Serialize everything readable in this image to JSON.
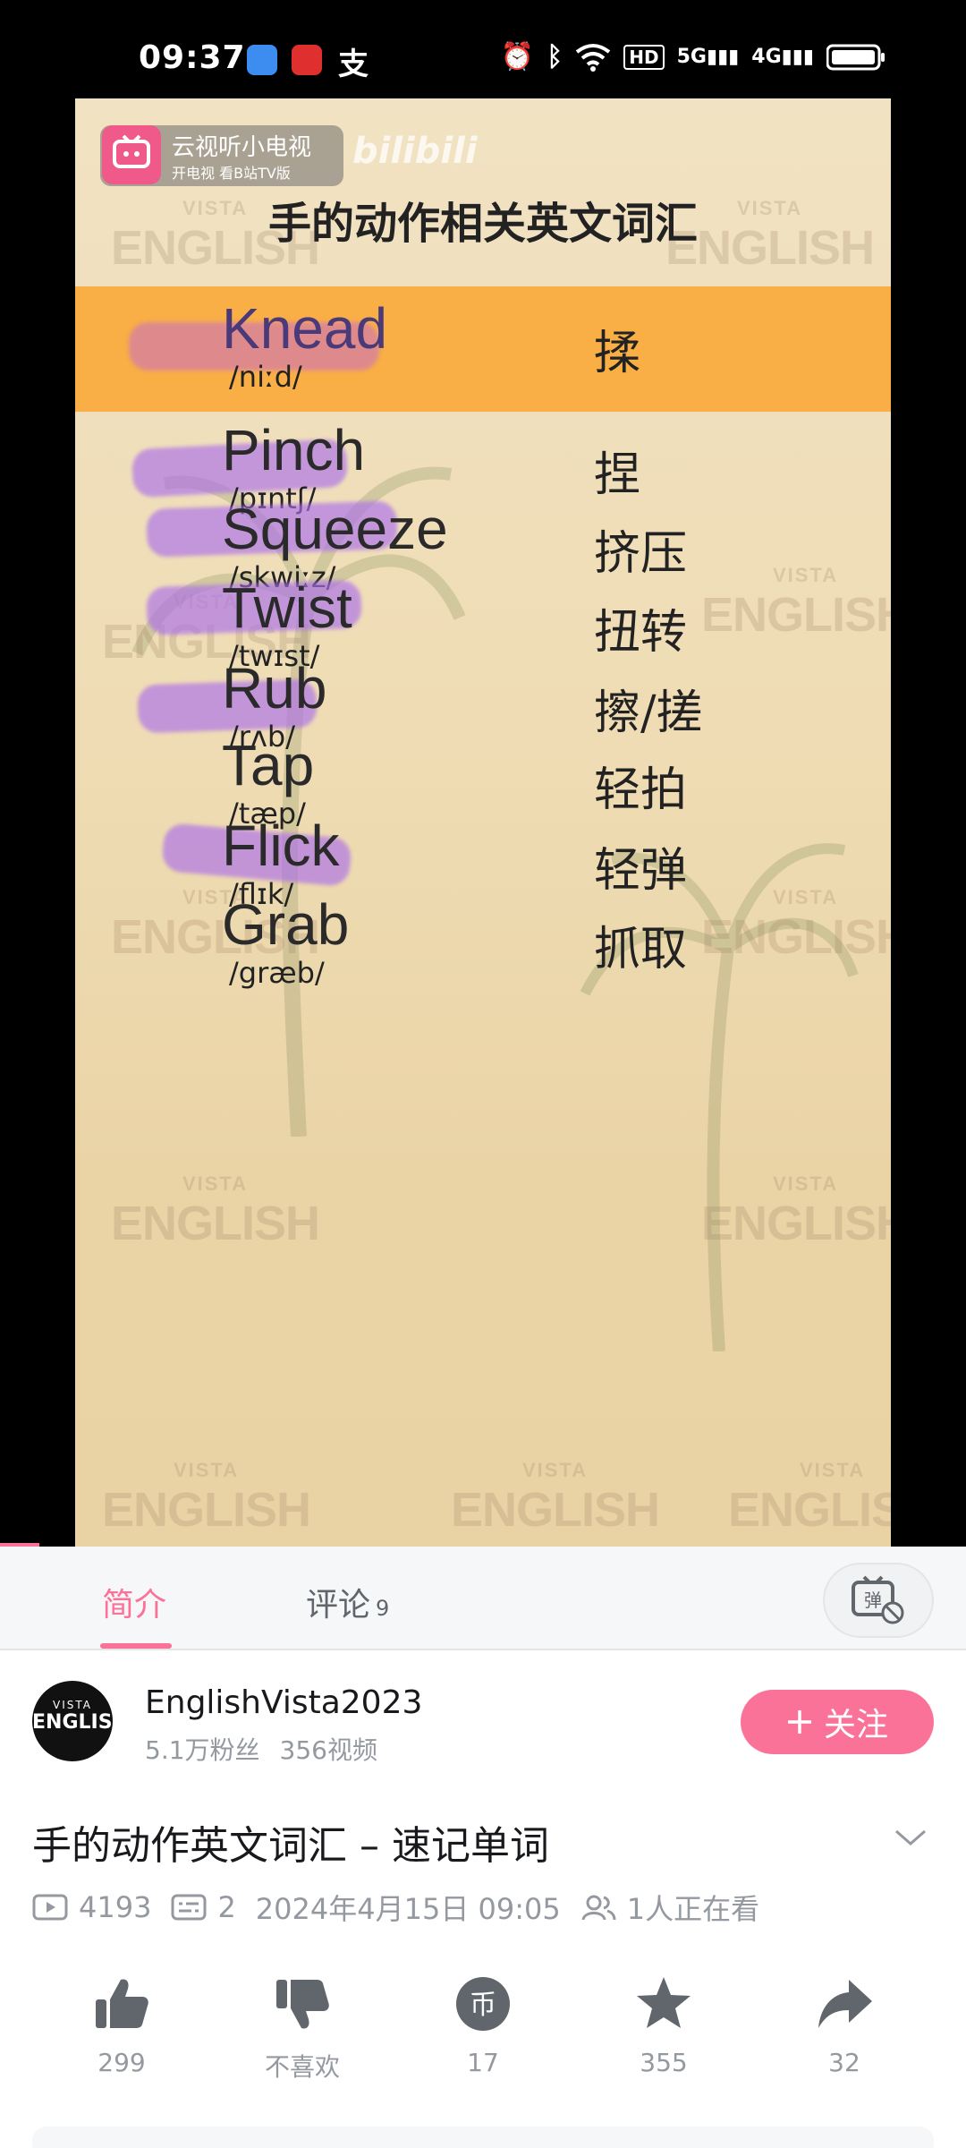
{
  "status_bar": {
    "time": "09:37",
    "icons": [
      "weather-icon",
      "bank-icon",
      "alipay-icon",
      "alarm-icon",
      "bluetooth-icon",
      "wifi-icon",
      "hd-icon",
      "signal-5g-icon",
      "signal-4g-icon",
      "battery-icon"
    ],
    "labels": {
      "hd": "HD",
      "g5": "5G",
      "g4": "4G"
    }
  },
  "video": {
    "tv_badge_title": "云视听小电视",
    "tv_badge_sub": "开电视 看B站TV版",
    "bili_logo": "bilibili",
    "title": "手的动作相关英文词汇",
    "watermark_top": "VISTA",
    "watermark_main": "ENGLISH",
    "words": [
      {
        "en": "Knead",
        "ipa": "/niːd/",
        "cn": "揉"
      },
      {
        "en": "Pinch",
        "ipa": "/pɪntʃ/",
        "cn": "捏"
      },
      {
        "en": "Squeeze",
        "ipa": "/skwiːz/",
        "cn": "挤压"
      },
      {
        "en": "Twist",
        "ipa": "/twɪst/",
        "cn": "扭转"
      },
      {
        "en": "Rub",
        "ipa": "/rʌb/",
        "cn": "擦/搓"
      },
      {
        "en": "Tap",
        "ipa": "/tæp/",
        "cn": "轻拍"
      },
      {
        "en": "Flick",
        "ipa": "/flɪk/",
        "cn": "轻弹"
      },
      {
        "en": "Grab",
        "ipa": "/græb/",
        "cn": "抓取"
      }
    ],
    "active_word_index": 0,
    "accent_color": "#f9ae46"
  },
  "tabs": {
    "intro": "简介",
    "comments": "评论",
    "comments_count": "9",
    "danmaku": "弹"
  },
  "uploader": {
    "avatar_top": "VISTA",
    "avatar_main": "ENGLISH",
    "name": "EnglishVista2023",
    "fans": "5.1万粉丝",
    "videos": "356视频",
    "follow_label": "关注",
    "brand_color": "#fb7299"
  },
  "video_info": {
    "title": "手的动作英文词汇 – 速记单词",
    "views": "4193",
    "danmaku_count": "2",
    "date": "2024年4月15日 09:05",
    "watching": "1人正在看"
  },
  "actions": {
    "like": "299",
    "dislike": "不喜欢",
    "coin": "17",
    "coin_glyph": "币",
    "favorite": "355",
    "share": "32"
  }
}
